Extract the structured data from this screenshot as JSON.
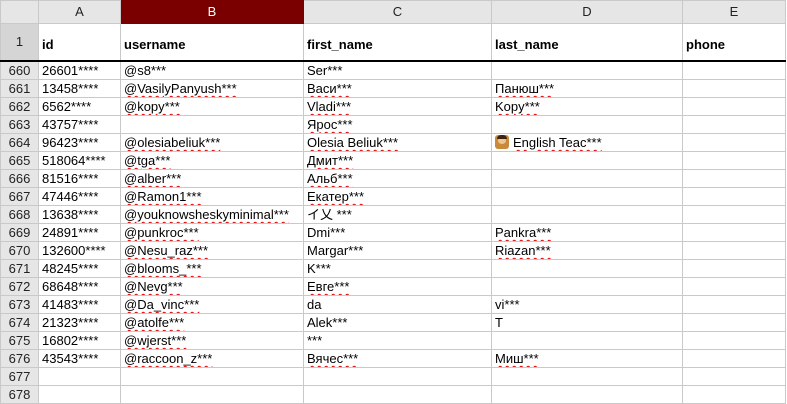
{
  "columns": [
    "A",
    "B",
    "C",
    "D",
    "E"
  ],
  "selected_column": "B",
  "header_row": {
    "number": "1",
    "cells": [
      "id",
      "username",
      "first_name",
      "last_name",
      "phone"
    ]
  },
  "rows": [
    {
      "n": "660",
      "cells": [
        "26601****",
        "@s8***",
        "Ser***",
        "",
        ""
      ]
    },
    {
      "n": "661",
      "cells": [
        "13458****",
        "@VasilyPanyush***",
        "Васи***",
        "Панюш***",
        ""
      ]
    },
    {
      "n": "662",
      "cells": [
        "6562****",
        "@kopy***",
        "Vladi***",
        "Kopy***",
        ""
      ]
    },
    {
      "n": "663",
      "cells": [
        "43757****",
        "",
        "Ярос***",
        "",
        ""
      ]
    },
    {
      "n": "664",
      "cells": [
        "96423****",
        "@olesiabeliuk***",
        "Olesia Beliuk***",
        "English Teac***",
        ""
      ]
    },
    {
      "n": "665",
      "cells": [
        "518064****",
        "@tga***",
        "Дмит***",
        "",
        ""
      ]
    },
    {
      "n": "666",
      "cells": [
        "81516****",
        "@alber***",
        "Альб***",
        "",
        ""
      ]
    },
    {
      "n": "667",
      "cells": [
        "47446****",
        "@Ramon1***",
        "Екатер***",
        "",
        ""
      ]
    },
    {
      "n": "668",
      "cells": [
        "13638****",
        "@youknowsheskyminimal***",
        "イ乂 ***",
        "",
        ""
      ]
    },
    {
      "n": "669",
      "cells": [
        "24891****",
        "@punkroc***",
        "Dmi***",
        "Pankra***",
        ""
      ]
    },
    {
      "n": "670",
      "cells": [
        "132600****",
        "@Nesu_raz***",
        "Margar***",
        "Riazan***",
        ""
      ]
    },
    {
      "n": "671",
      "cells": [
        "48245****",
        "@blooms_***",
        "K***",
        "",
        ""
      ]
    },
    {
      "n": "672",
      "cells": [
        "68648****",
        "@Nevg***",
        "Евге***",
        "",
        ""
      ]
    },
    {
      "n": "673",
      "cells": [
        "41483****",
        "@Da_vinc***",
        "da",
        "vi***",
        ""
      ]
    },
    {
      "n": "674",
      "cells": [
        "21323****",
        "@atolfe***",
        "Alek***",
        "T",
        ""
      ]
    },
    {
      "n": "675",
      "cells": [
        "16802****",
        "@wjerst***",
        "***",
        "",
        ""
      ]
    },
    {
      "n": "676",
      "cells": [
        "43543****",
        "@raccoon_z***",
        "Вячес***",
        "Миш***",
        ""
      ]
    },
    {
      "n": "677",
      "cells": [
        "",
        "",
        "",
        "",
        ""
      ]
    },
    {
      "n": "678",
      "cells": [
        "",
        "",
        "",
        "",
        ""
      ]
    }
  ],
  "colors": {
    "selected_header": "#7a0000",
    "header_bg": "#e6e6e6",
    "spellcheck": "#e00000"
  },
  "icons": {
    "teacher_emoji": "teacher-emoji-icon"
  }
}
